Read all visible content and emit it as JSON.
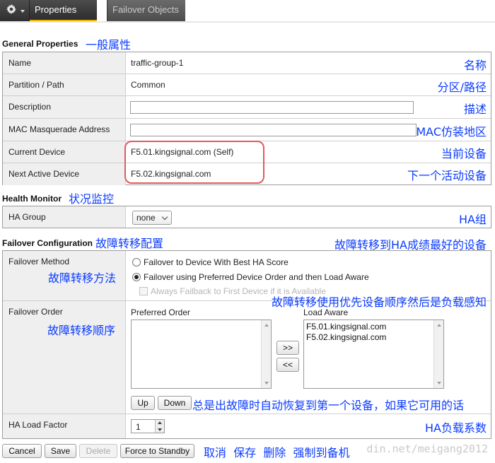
{
  "tabs": {
    "gear_icon": "gear-icon",
    "properties": "Properties",
    "failover_objects": "Failover Objects"
  },
  "general": {
    "header": "General Properties",
    "header_note": "一般属性",
    "rows": [
      {
        "label": "Name",
        "value": "traffic-group-1",
        "note": "名称"
      },
      {
        "label": "Partition / Path",
        "value": "Common",
        "note": "分区/路径"
      },
      {
        "label": "Description",
        "value": "",
        "note": "描述"
      },
      {
        "label": "MAC Masquerade Address",
        "value": "",
        "note": "MAC仿装地区"
      },
      {
        "label": "Current Device",
        "value": "F5.01.kingsignal.com (Self)",
        "note": "当前设备"
      },
      {
        "label": "Next Active Device",
        "value": "F5.02.kingsignal.com",
        "note": "下一个活动设备"
      }
    ]
  },
  "health": {
    "header": "Health Monitor",
    "header_note": "状况监控",
    "ha_group_label": "HA Group",
    "ha_group_value": "none",
    "ha_group_note": "HA组"
  },
  "failover": {
    "header": "Failover Configuration",
    "header_note": "故障转移配置",
    "header_note_right": "故障转移到HA成绩最好的设备",
    "method_label": "Failover Method",
    "method_note": "故障转移方法",
    "option_best_ha": "Failover to Device With Best HA Score",
    "option_preferred": "Failover using Preferred Device Order and then Load Aware",
    "option_always_failback": "Always Failback to First Device if it is Available",
    "preferred_note": "故障转移使用优先设备顺序然后是负载感知",
    "order_label": "Failover Order",
    "order_note": "故障转移顺序",
    "preferred_order_title": "Preferred Order",
    "load_aware_title": "Load Aware",
    "load_aware_items": [
      "F5.01.kingsignal.com",
      "F5.02.kingsignal.com"
    ],
    "move_right": ">>",
    "move_left": "<<",
    "up": "Up",
    "down": "Down",
    "failback_note": "总是出故障时自动恢复到第一个设备，如果它可用的话",
    "load_factor_label": "HA Load Factor",
    "load_factor_value": "1",
    "load_factor_note": "HA负载系数"
  },
  "actions": {
    "cancel": "Cancel",
    "save": "Save",
    "delete": "Delete",
    "force_standby": "Force to Standby",
    "note": "取消  保存  删除  强制到备机"
  },
  "watermark": "din.net/meigang2012"
}
